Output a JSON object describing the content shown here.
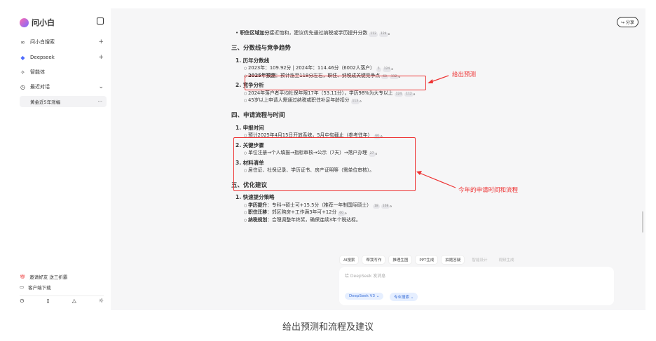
{
  "sidebar": {
    "brand": "问小白",
    "items": [
      {
        "icon": "link-icon",
        "label": "问小白搜索",
        "action": "+"
      },
      {
        "icon": "deepseek-icon",
        "label": "Deepseek",
        "action": "+"
      },
      {
        "icon": "agent-icon",
        "label": "智能体"
      },
      {
        "icon": "history-icon",
        "label": "最近对话",
        "action": "⌄"
      }
    ],
    "history": [
      "黄金近5年涨幅"
    ],
    "bottom": [
      {
        "icon": "gift-icon",
        "label": "邀请好友 送三折霸"
      },
      {
        "icon": "monitor-icon",
        "label": "客户端下载"
      }
    ]
  },
  "header": {
    "share": "分享"
  },
  "content": {
    "top_bullet_bold": "职住区域加分",
    "top_bullet": "接近饱和，建议优先通过纳税或学历提升分数",
    "top_cites": [
      "112",
      "124"
    ],
    "sec3": {
      "title": "三、分数线与竞争趋势",
      "items": [
        {
          "title": "1. 历年分数线",
          "subs": [
            {
              "text": "2023年：109.92分 | 2024年：114.46分（6002人落户）",
              "cites": [
                "5",
                "124"
              ]
            },
            {
              "bold": "2025年预测",
              "text": "：预计涨至118分左右，职住、纳税成关键竞争点",
              "cites": [
                "68",
                "112"
              ]
            }
          ]
        },
        {
          "title": "2. 竞争分析",
          "subs": [
            {
              "text": "2024年落户者平均社保年限17年（53.11分），学历98%为大专以上",
              "cites": [
                "124",
                "112"
              ]
            },
            {
              "text": "45岁以上申请人需通过纳税或职住补足年龄扣分",
              "cites": [
                "113"
              ]
            }
          ]
        }
      ]
    },
    "sec4": {
      "title": "四、申请流程与时间",
      "items": [
        {
          "title": "1. 申报时间",
          "sub": "预计2025年4月15日开放系统，5月中旬截止（参考往年）",
          "cite": "60"
        },
        {
          "title": "2. 关键步骤",
          "sub": "单位注册→个人填报→指标审核→公示（7天）→落户办理",
          "cite": "27"
        },
        {
          "title": "3. 材料清单",
          "sub": "居住证、社保记录、学历证书、房产证明等（需单位审核）"
        }
      ]
    },
    "sec5": {
      "title": "五、优化建议",
      "item": "1. 快速提分策略",
      "subs": [
        {
          "bold": "学历提升",
          "text": "：专科→硕士可+15.5分（推荐一年制国际硕士）",
          "cites": [
            "18",
            "108"
          ]
        },
        {
          "bold": "职住迁移",
          "text": "：郊区购房+工作满3年可+12分",
          "cites": [
            "60"
          ]
        },
        {
          "bold": "纳税规划",
          "text": "：合理调整年终奖，确保连续3年个税达标"
        }
      ]
    }
  },
  "annotations": {
    "a1": "给出预测",
    "a2": "今年的申请时间和流程"
  },
  "tools": [
    "AI搜索",
    "帮我写作",
    "推理生图",
    "PPT生成",
    "拍题答疑",
    "智能设计",
    "视频生成"
  ],
  "input": {
    "placeholder": "给 DeepSeek 发消息",
    "model": "DeepSeek V3 ⌄",
    "search": "专业搜索 ⌄"
  },
  "caption": "给出预测和流程及建议",
  "colors": {
    "annotation": "#e33333",
    "chip": "#3a6fd8"
  }
}
